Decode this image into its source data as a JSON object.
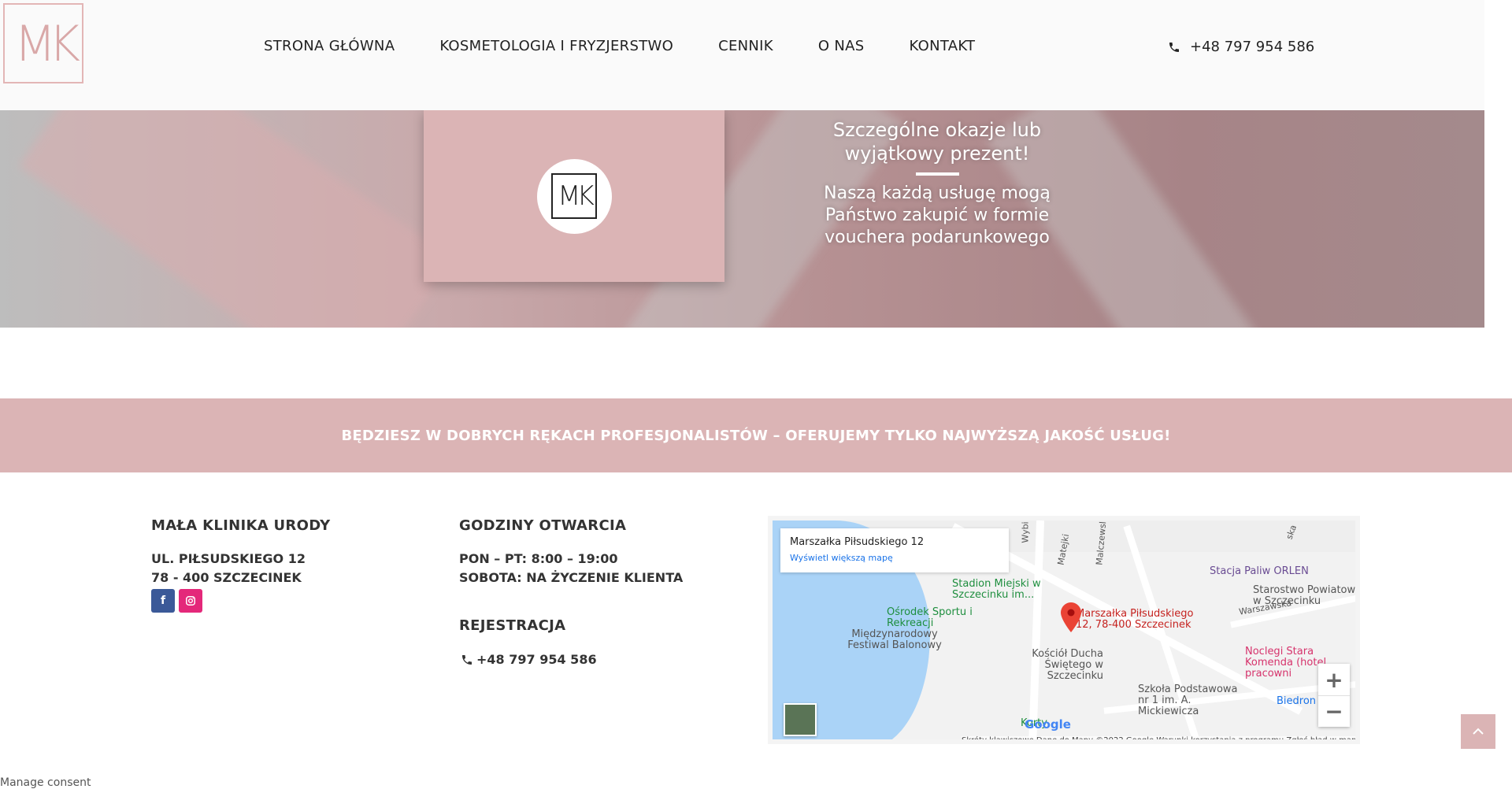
{
  "header": {
    "logo_text": "MK",
    "nav": [
      "STRONA GŁÓWNA",
      "KOSMETOLOGIA I FRYZJERSTWO",
      "CENNIK",
      "O NAS",
      "KONTAKT"
    ],
    "phone": "+48 797 954 586"
  },
  "hero": {
    "card_logo": "MK",
    "title": "Szczególne okazje lub wyjątkowy prezent!",
    "text": "Naszą każdą usługę mogą Państwo zakupić w formie vouchera podarunkowego"
  },
  "banner": {
    "text": "BĘDZIESZ W DOBRYCH RĘKACH PROFESJONALISTÓW – OFERUJEMY TYLKO NAJWYŻSZĄ JAKOŚĆ USŁUG!"
  },
  "footer": {
    "col1": {
      "title": "MAŁA KLINIKA URODY",
      "address_line1": "UL. PIŁSUDSKIEGO 12",
      "address_line2": "78 - 400 SZCZECINEK"
    },
    "col2": {
      "title": "GODZINY OTWARCIA",
      "hours_line1": "PON – PT: 8:00 – 19:00",
      "hours_line2": "SOBOTA: NA ŻYCZENIE KLIENTA",
      "reg_title": "REJESTRACJA",
      "reg_phone": "+48 797 954 586"
    }
  },
  "map": {
    "card_title": "Marszałka Piłsudskiego 12",
    "card_link": "Wyświetl większą mapę",
    "labels": {
      "orlen": "Stacja Paliw ORLEN",
      "starostwo": "Starostwo Powiatowe w Szczecinku",
      "stadion": "Stadion Miejski w Szczecinku im...",
      "osrodek": "Ośrodek Sportu i Rekreacji",
      "festiwal": "Międzynarodowy Festiwal Balonowy",
      "pin": "Marszałka Piłsudskiego 12, 78-400 Szczecinek",
      "kosciol": "Kościół Ducha Świętego w Szczecinku",
      "noclegi": "Noclegi Stara Komenda (hotel pracowni",
      "szkola": "Szkoła Podstawowa nr 1 im. A. Mickiewicza",
      "biedronka": "Biedron",
      "korty": "Korty",
      "warszawska": "Warszawska",
      "wyb": "Wybi",
      "mateja": "Matejki",
      "malcz": "Malczewsl",
      "ska": "ska"
    },
    "google_logo": "Google",
    "footer_text": "Skróty klawiszowe   Dane do Mapy ©2022 Google   Warunki korzystania z programu   Zgłoś błąd w mapach"
  },
  "consent": "Manage consent",
  "icons": {
    "phone": "phone-icon",
    "facebook": "facebook-icon",
    "instagram": "instagram-icon",
    "scroll_top": "chevron-up-icon"
  }
}
